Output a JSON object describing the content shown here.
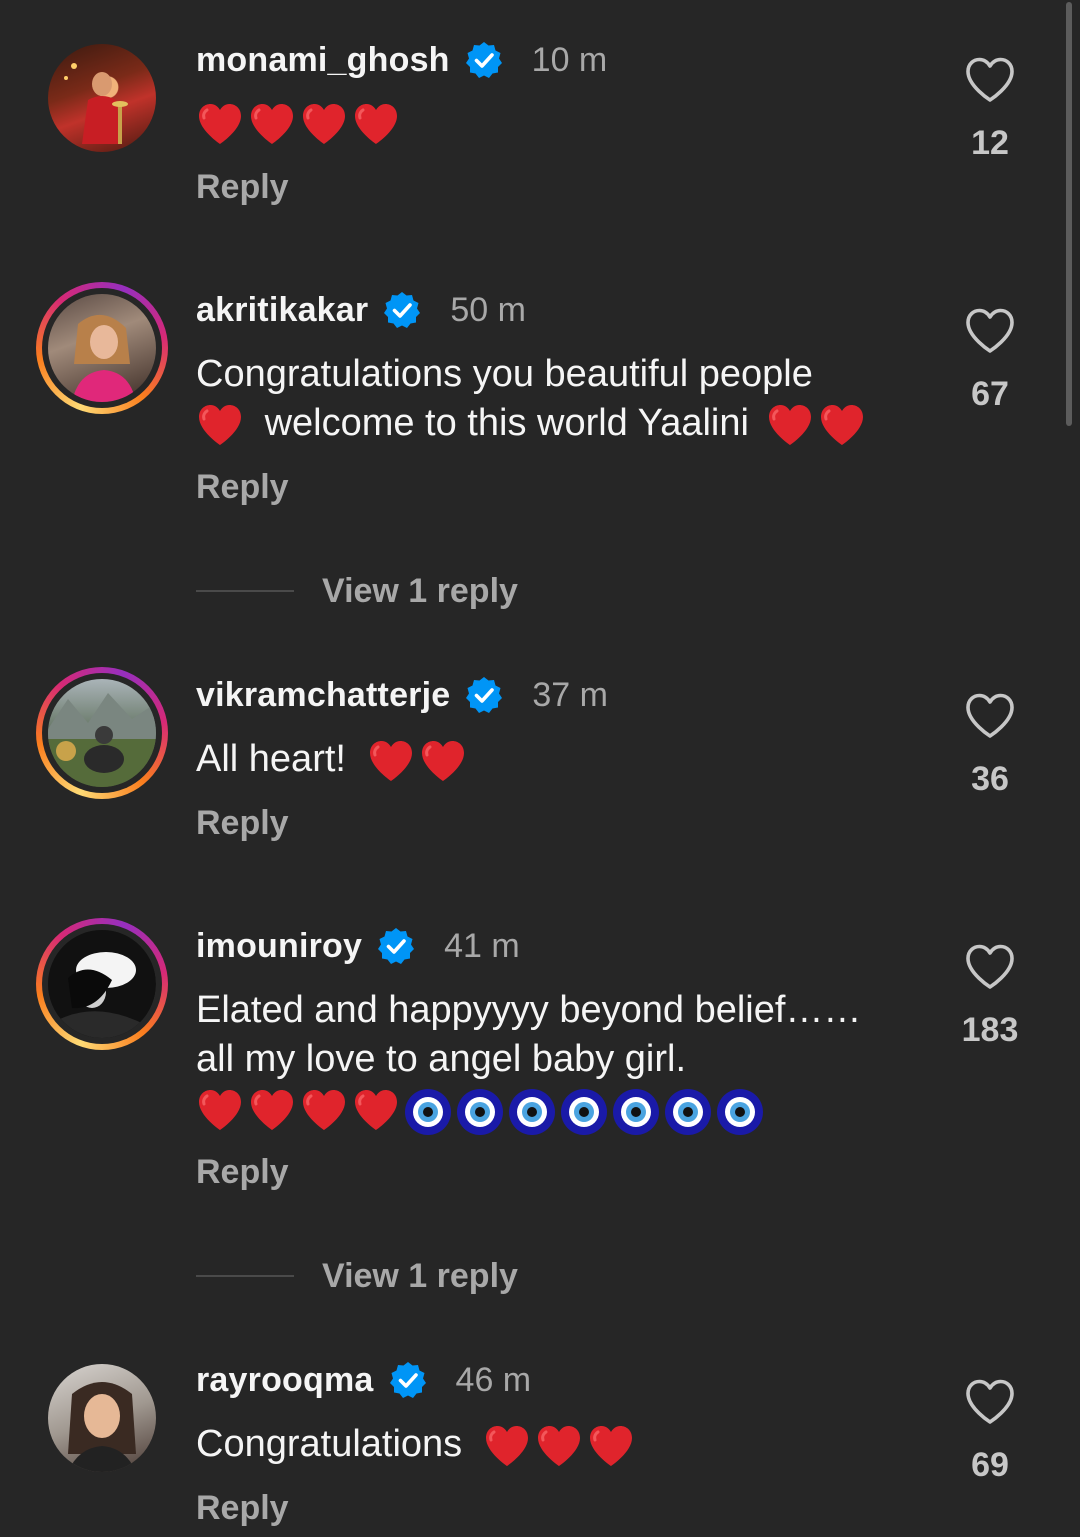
{
  "comments": [
    {
      "username": "monami_ghosh",
      "time": "10 m",
      "text_before": "",
      "text_after": "",
      "hearts": 4,
      "likes": "12",
      "reply": "Reply",
      "verified": true
    },
    {
      "username": "akritikakar",
      "time": "50 m",
      "line1": "Congratulations you beautiful people",
      "line2": "welcome to this world Yaalini",
      "likes": "67",
      "reply": "Reply",
      "view_replies": "View 1 reply",
      "verified": true
    },
    {
      "username": "vikramchatterje",
      "time": "37 m",
      "text": "All heart!",
      "likes": "36",
      "reply": "Reply",
      "verified": true
    },
    {
      "username": "imouniroy",
      "time": "41 m",
      "line1": "Elated and happyyyy beyond belief……",
      "line2": "all my love to angel baby girl.",
      "likes": "183",
      "reply": "Reply",
      "view_replies": "View 1 reply",
      "verified": true
    },
    {
      "username": "rayrooqma",
      "time": "46 m",
      "text": "Congratulations",
      "likes": "69",
      "reply": "Reply",
      "verified": true
    }
  ],
  "colors": {
    "background": "#262626",
    "verified_blue": "#0095f6",
    "heart_red": "#e0242c",
    "secondary_text": "#a8a8a8"
  },
  "icons": {
    "like": "heart-outline-icon",
    "verified": "verified-badge-icon",
    "emoji_heart": "red-heart-emoji",
    "emoji_nazar": "nazar-amulet-emoji"
  }
}
